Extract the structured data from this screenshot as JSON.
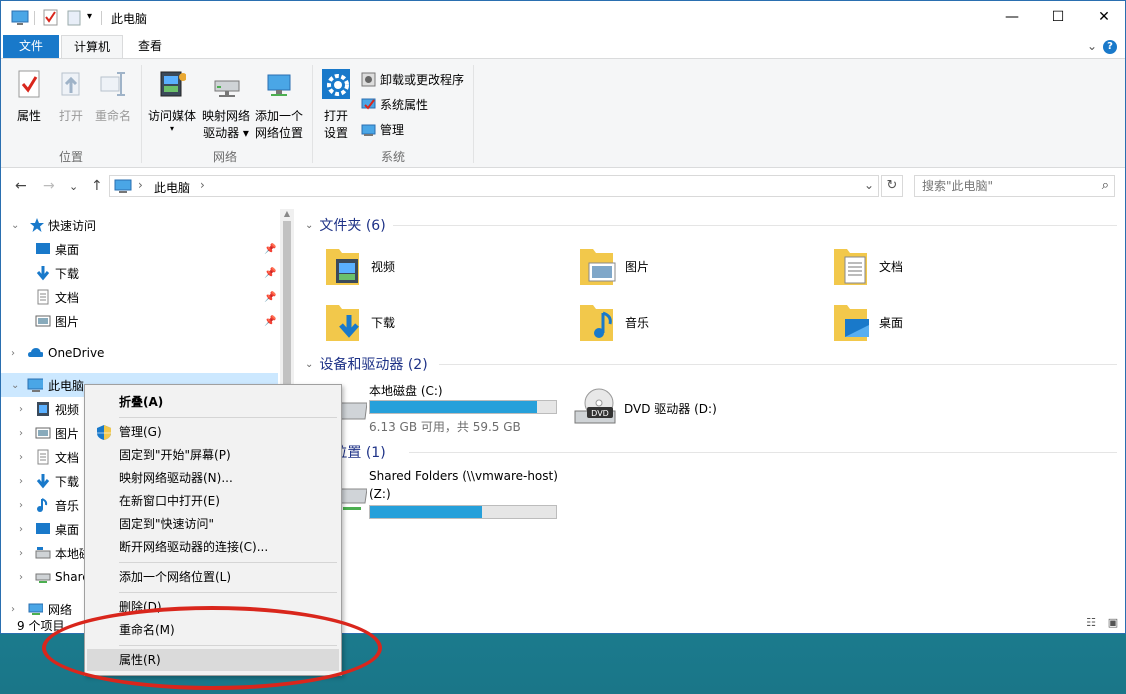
{
  "window": {
    "title": "此电脑",
    "minimize": "—",
    "maximize": "☐",
    "close": "✕"
  },
  "ribbon": {
    "tabs": [
      "文件",
      "计算机",
      "查看"
    ],
    "collapse_glyph": "⌄",
    "help_glyph": "?",
    "location_group": {
      "label": "位置",
      "buttons": [
        "属性",
        "打开",
        "重命名"
      ]
    },
    "network_group": {
      "label": "网络",
      "access_media": "访问媒体",
      "access_media_arrow": "▾",
      "map_drive_line1": "映射网络",
      "map_drive_line2": "驱动器 ▾",
      "add_location_line1": "添加一个",
      "add_location_line2": "网络位置"
    },
    "system_group": {
      "label": "系统",
      "open_settings_line1": "打开",
      "open_settings_line2": "设置",
      "uninstall": "卸载或更改程序",
      "system_props": "系统属性",
      "manage": "管理"
    }
  },
  "navbar": {
    "back": "←",
    "forward": "→",
    "recent": "⌄",
    "up": "↑",
    "breadcrumb_sep": "›",
    "breadcrumb": "此电脑",
    "dropdown": "⌄",
    "refresh": "↻",
    "search_placeholder": "搜索\"此电脑\"",
    "search_glyph": "⌕"
  },
  "nav_pane": {
    "quick_access": "快速访问",
    "quick_items": [
      "桌面",
      "下载",
      "文档",
      "图片"
    ],
    "onedrive": "OneDrive",
    "this_pc": "此电脑",
    "pc_items": [
      "视频",
      "图片",
      "文档",
      "下载",
      "音乐",
      "桌面",
      "本地磁",
      "Share"
    ],
    "network": "网络"
  },
  "content": {
    "folders_header": "文件夹 (6)",
    "folders": [
      "视频",
      "图片",
      "文档",
      "下载",
      "音乐",
      "桌面"
    ],
    "devices_header": "设备和驱动器 (2)",
    "local_disk": {
      "name": "本地磁盘 (C:)",
      "free_text": "6.13 GB 可用，共 59.5 GB",
      "used_fraction": 0.9
    },
    "dvd": {
      "name": "DVD 驱动器 (D:)",
      "icon_text": "DVD"
    },
    "network_header": "络位置 (1)",
    "shared": {
      "name_line1": "Shared Folders (\\\\vmware-host)",
      "name_line2": "(Z:)",
      "used_fraction": 0.6
    }
  },
  "status_bar": {
    "items": "9 个项目"
  },
  "context_menu": {
    "collapse": "折叠(A)",
    "manage": "管理(G)",
    "pin_start": "固定到\"开始\"屏幕(P)",
    "map_drive": "映射网络驱动器(N)...",
    "open_new_window": "在新窗口中打开(E)",
    "pin_quick": "固定到\"快速访问\"",
    "disconnect": "断开网络驱动器的连接(C)...",
    "add_location": "添加一个网络位置(L)",
    "delete": "删除(D)",
    "rename": "重命名(M)",
    "properties": "属性(R)"
  },
  "colors": {
    "accent": "#1979ca",
    "selection": "#cce8ff",
    "section_header": "#1e3287",
    "drive_bar": "#26a0da",
    "annotation_ring": "#d9261c"
  }
}
